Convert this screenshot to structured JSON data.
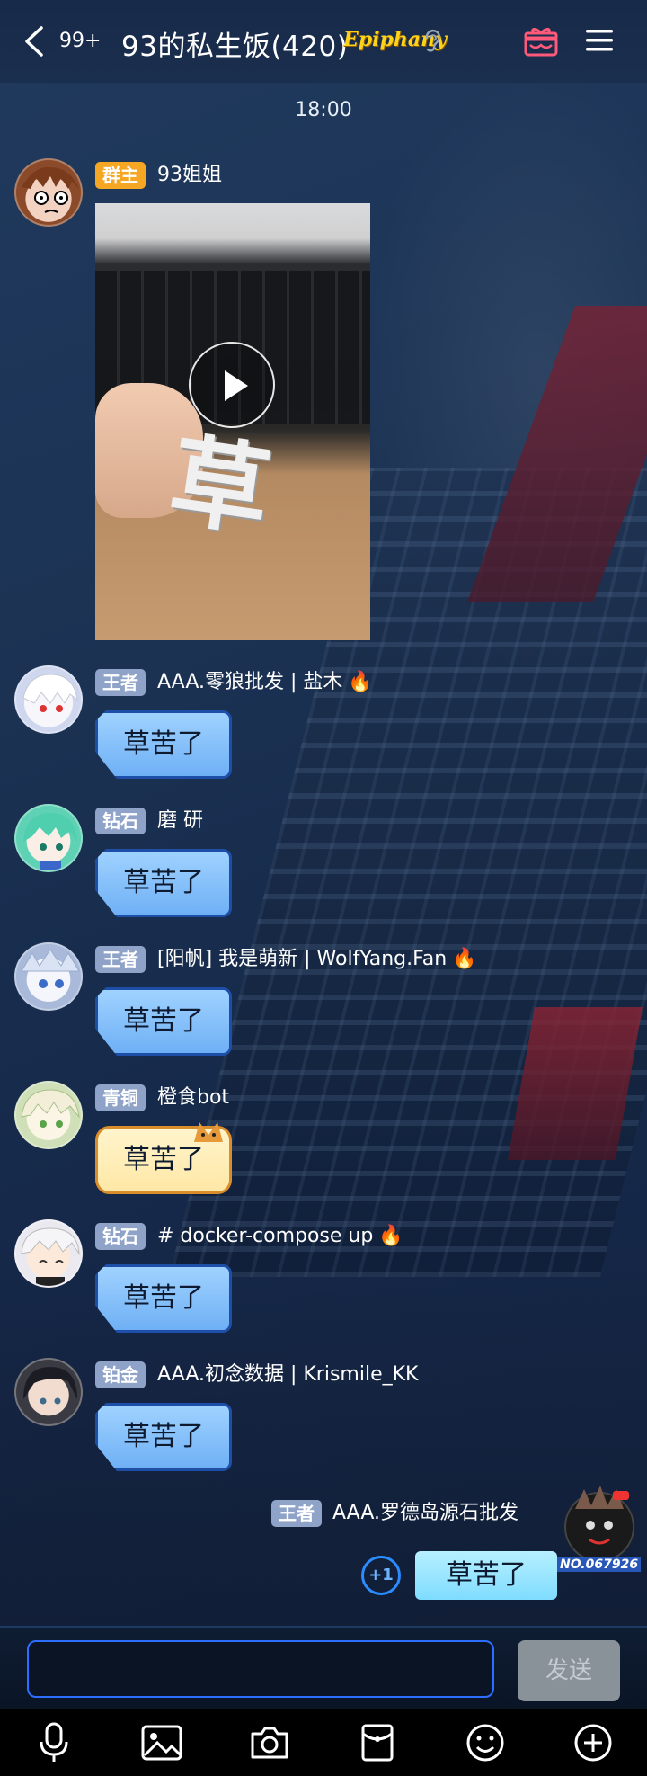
{
  "header": {
    "unread_count": "99+",
    "title": "93的私生饭(420)",
    "brand_text": "Epiphany"
  },
  "time_divider": "18:00",
  "messages": [
    {
      "badge": "群主",
      "badge_color": "#f5a623",
      "nick": "93姐姐",
      "type": "video"
    },
    {
      "badge": "王者",
      "badge_color": "#8fa3c8",
      "nick": "AAA.零狼批发 | 盐木",
      "fire": true,
      "text": "草苦了"
    },
    {
      "badge": "钻石",
      "badge_color": "#8fa3c8",
      "nick": "磨 研",
      "text": "草苦了"
    },
    {
      "badge": "王者",
      "badge_color": "#8fa3c8",
      "nick": "[阳帆] 我是萌新 | WolfYang.Fan",
      "fire": true,
      "text": "草苦了"
    },
    {
      "badge": "青铜",
      "badge_color": "#8fa3c8",
      "nick": "橙食bot",
      "text": "草苦了"
    },
    {
      "badge": "钻石",
      "badge_color": "#8fa3c8",
      "nick": "# docker-compose up",
      "fire": true,
      "text": "草苦了"
    },
    {
      "badge": "铂金",
      "badge_color": "#8fa3c8",
      "nick": "AAA.初念数据 | Krismile_KK",
      "text": "草苦了"
    }
  ],
  "video_glyph": "草",
  "own_message": {
    "badge": "王者",
    "nick": "AAA.罗德岛源石批发",
    "plus_one": "+1",
    "text": "草苦了",
    "avatar_number": "NO.067926"
  },
  "input": {
    "placeholder": "",
    "send_label": "发送"
  },
  "fire_glyph": "🔥",
  "icons": [
    "back-arrow-icon",
    "ear-icon",
    "gift-icon",
    "menu-icon",
    "mic-icon",
    "image-icon",
    "camera-icon",
    "red-packet-icon",
    "emoji-icon",
    "plus-icon",
    "play-icon"
  ]
}
